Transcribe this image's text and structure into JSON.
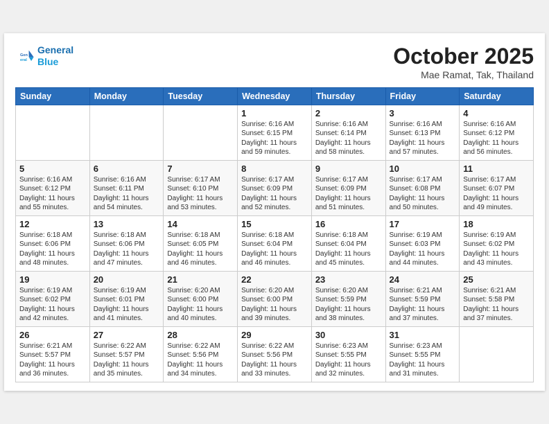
{
  "logo": {
    "line1": "General",
    "line2": "Blue"
  },
  "title": "October 2025",
  "location": "Mae Ramat, Tak, Thailand",
  "days_of_week": [
    "Sunday",
    "Monday",
    "Tuesday",
    "Wednesday",
    "Thursday",
    "Friday",
    "Saturday"
  ],
  "weeks": [
    [
      {
        "day": "",
        "info": ""
      },
      {
        "day": "",
        "info": ""
      },
      {
        "day": "",
        "info": ""
      },
      {
        "day": "1",
        "info": "Sunrise: 6:16 AM\nSunset: 6:15 PM\nDaylight: 11 hours\nand 59 minutes."
      },
      {
        "day": "2",
        "info": "Sunrise: 6:16 AM\nSunset: 6:14 PM\nDaylight: 11 hours\nand 58 minutes."
      },
      {
        "day": "3",
        "info": "Sunrise: 6:16 AM\nSunset: 6:13 PM\nDaylight: 11 hours\nand 57 minutes."
      },
      {
        "day": "4",
        "info": "Sunrise: 6:16 AM\nSunset: 6:12 PM\nDaylight: 11 hours\nand 56 minutes."
      }
    ],
    [
      {
        "day": "5",
        "info": "Sunrise: 6:16 AM\nSunset: 6:12 PM\nDaylight: 11 hours\nand 55 minutes."
      },
      {
        "day": "6",
        "info": "Sunrise: 6:16 AM\nSunset: 6:11 PM\nDaylight: 11 hours\nand 54 minutes."
      },
      {
        "day": "7",
        "info": "Sunrise: 6:17 AM\nSunset: 6:10 PM\nDaylight: 11 hours\nand 53 minutes."
      },
      {
        "day": "8",
        "info": "Sunrise: 6:17 AM\nSunset: 6:09 PM\nDaylight: 11 hours\nand 52 minutes."
      },
      {
        "day": "9",
        "info": "Sunrise: 6:17 AM\nSunset: 6:09 PM\nDaylight: 11 hours\nand 51 minutes."
      },
      {
        "day": "10",
        "info": "Sunrise: 6:17 AM\nSunset: 6:08 PM\nDaylight: 11 hours\nand 50 minutes."
      },
      {
        "day": "11",
        "info": "Sunrise: 6:17 AM\nSunset: 6:07 PM\nDaylight: 11 hours\nand 49 minutes."
      }
    ],
    [
      {
        "day": "12",
        "info": "Sunrise: 6:18 AM\nSunset: 6:06 PM\nDaylight: 11 hours\nand 48 minutes."
      },
      {
        "day": "13",
        "info": "Sunrise: 6:18 AM\nSunset: 6:06 PM\nDaylight: 11 hours\nand 47 minutes."
      },
      {
        "day": "14",
        "info": "Sunrise: 6:18 AM\nSunset: 6:05 PM\nDaylight: 11 hours\nand 46 minutes."
      },
      {
        "day": "15",
        "info": "Sunrise: 6:18 AM\nSunset: 6:04 PM\nDaylight: 11 hours\nand 46 minutes."
      },
      {
        "day": "16",
        "info": "Sunrise: 6:18 AM\nSunset: 6:04 PM\nDaylight: 11 hours\nand 45 minutes."
      },
      {
        "day": "17",
        "info": "Sunrise: 6:19 AM\nSunset: 6:03 PM\nDaylight: 11 hours\nand 44 minutes."
      },
      {
        "day": "18",
        "info": "Sunrise: 6:19 AM\nSunset: 6:02 PM\nDaylight: 11 hours\nand 43 minutes."
      }
    ],
    [
      {
        "day": "19",
        "info": "Sunrise: 6:19 AM\nSunset: 6:02 PM\nDaylight: 11 hours\nand 42 minutes."
      },
      {
        "day": "20",
        "info": "Sunrise: 6:19 AM\nSunset: 6:01 PM\nDaylight: 11 hours\nand 41 minutes."
      },
      {
        "day": "21",
        "info": "Sunrise: 6:20 AM\nSunset: 6:00 PM\nDaylight: 11 hours\nand 40 minutes."
      },
      {
        "day": "22",
        "info": "Sunrise: 6:20 AM\nSunset: 6:00 PM\nDaylight: 11 hours\nand 39 minutes."
      },
      {
        "day": "23",
        "info": "Sunrise: 6:20 AM\nSunset: 5:59 PM\nDaylight: 11 hours\nand 38 minutes."
      },
      {
        "day": "24",
        "info": "Sunrise: 6:21 AM\nSunset: 5:59 PM\nDaylight: 11 hours\nand 37 minutes."
      },
      {
        "day": "25",
        "info": "Sunrise: 6:21 AM\nSunset: 5:58 PM\nDaylight: 11 hours\nand 37 minutes."
      }
    ],
    [
      {
        "day": "26",
        "info": "Sunrise: 6:21 AM\nSunset: 5:57 PM\nDaylight: 11 hours\nand 36 minutes."
      },
      {
        "day": "27",
        "info": "Sunrise: 6:22 AM\nSunset: 5:57 PM\nDaylight: 11 hours\nand 35 minutes."
      },
      {
        "day": "28",
        "info": "Sunrise: 6:22 AM\nSunset: 5:56 PM\nDaylight: 11 hours\nand 34 minutes."
      },
      {
        "day": "29",
        "info": "Sunrise: 6:22 AM\nSunset: 5:56 PM\nDaylight: 11 hours\nand 33 minutes."
      },
      {
        "day": "30",
        "info": "Sunrise: 6:23 AM\nSunset: 5:55 PM\nDaylight: 11 hours\nand 32 minutes."
      },
      {
        "day": "31",
        "info": "Sunrise: 6:23 AM\nSunset: 5:55 PM\nDaylight: 11 hours\nand 31 minutes."
      },
      {
        "day": "",
        "info": ""
      }
    ]
  ]
}
